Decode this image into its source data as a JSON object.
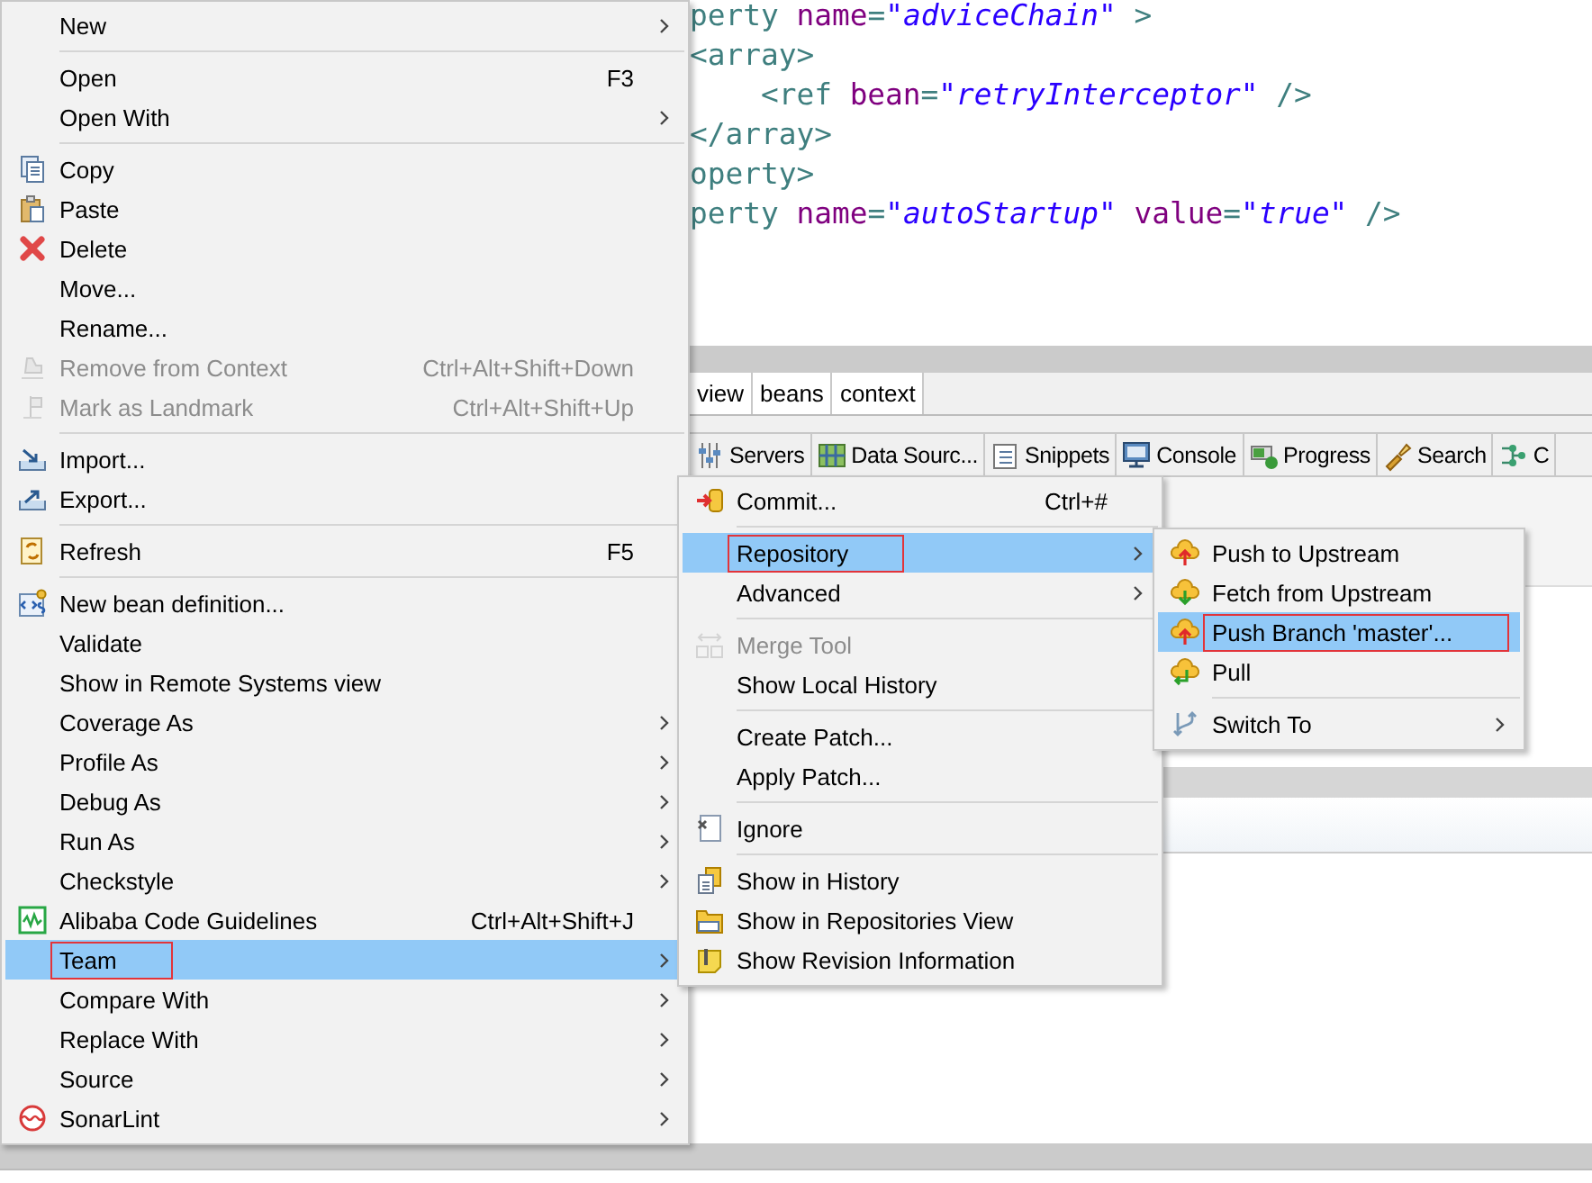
{
  "editor": {
    "lines": [
      [
        {
          "text": "perty ",
          "kind": "tag"
        },
        {
          "text": "name",
          "kind": "attr"
        },
        {
          "text": "=",
          "kind": "tag"
        },
        {
          "text": "\"adviceChain\"",
          "kind": "value"
        },
        {
          "text": " >",
          "kind": "tag"
        }
      ],
      [
        {
          "text": "<array>",
          "kind": "tag"
        }
      ],
      [
        {
          "text": "    <ref ",
          "kind": "tag"
        },
        {
          "text": "bean",
          "kind": "attr"
        },
        {
          "text": "=",
          "kind": "tag"
        },
        {
          "text": "\"retryInterceptor\"",
          "kind": "value"
        },
        {
          "text": " />",
          "kind": "tag"
        }
      ],
      [
        {
          "text": "</array>",
          "kind": "tag"
        }
      ],
      [
        {
          "text": "operty>",
          "kind": "tag"
        }
      ],
      [
        {
          "text": "perty ",
          "kind": "tag"
        },
        {
          "text": "name",
          "kind": "attr"
        },
        {
          "text": "=",
          "kind": "tag"
        },
        {
          "text": "\"autoStartup\"",
          "kind": "value"
        },
        {
          "text": " value",
          "kind": "attr"
        },
        {
          "text": "=",
          "kind": "tag"
        },
        {
          "text": "\"true\"",
          "kind": "value"
        },
        {
          "text": " />",
          "kind": "tag"
        }
      ]
    ]
  },
  "editor_tabs": [
    "view",
    "beans",
    "context"
  ],
  "view_tabs": [
    "Servers",
    "Data Sourc...",
    "Snippets",
    "Console",
    "Progress",
    "Search",
    "C"
  ],
  "main_menu": {
    "groups": [
      [
        {
          "label": "New",
          "submenu": true,
          "disabled": false,
          "selected": false,
          "annotated": false
        }
      ],
      [
        {
          "label": "Open",
          "shortcut": "F3",
          "submenu": false,
          "disabled": false,
          "selected": false,
          "annotated": false
        },
        {
          "label": "Open With",
          "submenu": true,
          "disabled": false,
          "selected": false,
          "annotated": false
        }
      ],
      [
        {
          "label": "Copy",
          "submenu": false,
          "disabled": false,
          "selected": false,
          "annotated": false
        },
        {
          "label": "Paste",
          "submenu": false,
          "disabled": false,
          "selected": false,
          "annotated": false
        },
        {
          "label": "Delete",
          "submenu": false,
          "disabled": false,
          "selected": false,
          "annotated": false
        },
        {
          "label": "Move...",
          "submenu": false,
          "disabled": false,
          "selected": false,
          "annotated": false
        },
        {
          "label": "Rename...",
          "submenu": false,
          "disabled": false,
          "selected": false,
          "annotated": false
        },
        {
          "label": "Remove from Context",
          "shortcut": "Ctrl+Alt+Shift+Down",
          "submenu": false,
          "disabled": true,
          "selected": false,
          "annotated": false
        },
        {
          "label": "Mark as Landmark",
          "shortcut": "Ctrl+Alt+Shift+Up",
          "submenu": false,
          "disabled": true,
          "selected": false,
          "annotated": false
        }
      ],
      [
        {
          "label": "Import...",
          "submenu": false,
          "disabled": false,
          "selected": false,
          "annotated": false
        },
        {
          "label": "Export...",
          "submenu": false,
          "disabled": false,
          "selected": false,
          "annotated": false
        }
      ],
      [
        {
          "label": "Refresh",
          "shortcut": "F5",
          "submenu": false,
          "disabled": false,
          "selected": false,
          "annotated": false
        }
      ],
      [
        {
          "label": "New bean definition...",
          "submenu": false,
          "disabled": false,
          "selected": false,
          "annotated": false
        },
        {
          "label": "Validate",
          "submenu": false,
          "disabled": false,
          "selected": false,
          "annotated": false
        },
        {
          "label": "Show in Remote Systems view",
          "submenu": false,
          "disabled": false,
          "selected": false,
          "annotated": false
        },
        {
          "label": "Coverage As",
          "submenu": true,
          "disabled": false,
          "selected": false,
          "annotated": false
        },
        {
          "label": "Profile As",
          "submenu": true,
          "disabled": false,
          "selected": false,
          "annotated": false
        },
        {
          "label": "Debug As",
          "submenu": true,
          "disabled": false,
          "selected": false,
          "annotated": false
        },
        {
          "label": "Run As",
          "submenu": true,
          "disabled": false,
          "selected": false,
          "annotated": false
        },
        {
          "label": "Checkstyle",
          "submenu": true,
          "disabled": false,
          "selected": false,
          "annotated": false
        },
        {
          "label": "Alibaba Code Guidelines",
          "shortcut": "Ctrl+Alt+Shift+J",
          "submenu": false,
          "disabled": false,
          "selected": false,
          "annotated": false
        },
        {
          "label": "Team",
          "submenu": true,
          "disabled": false,
          "selected": true,
          "annotated": true
        },
        {
          "label": "Compare With",
          "submenu": true,
          "disabled": false,
          "selected": false,
          "annotated": false
        },
        {
          "label": "Replace With",
          "submenu": true,
          "disabled": false,
          "selected": false,
          "annotated": false
        },
        {
          "label": "Source",
          "submenu": true,
          "disabled": false,
          "selected": false,
          "annotated": false
        },
        {
          "label": "SonarLint",
          "submenu": true,
          "disabled": false,
          "selected": false,
          "annotated": false
        }
      ]
    ]
  },
  "team_menu": {
    "groups": [
      [
        {
          "label": "Commit...",
          "shortcut": "Ctrl+#",
          "submenu": false,
          "disabled": false,
          "selected": false,
          "annotated": false
        }
      ],
      [
        {
          "label": "Repository",
          "submenu": true,
          "disabled": false,
          "selected": true,
          "annotated": true
        },
        {
          "label": "Advanced",
          "submenu": true,
          "disabled": false,
          "selected": false,
          "annotated": false
        }
      ],
      [
        {
          "label": "Merge Tool",
          "submenu": false,
          "disabled": true,
          "selected": false,
          "annotated": false
        },
        {
          "label": "Show Local History",
          "submenu": false,
          "disabled": false,
          "selected": false,
          "annotated": false
        }
      ],
      [
        {
          "label": "Create Patch...",
          "submenu": false,
          "disabled": false,
          "selected": false,
          "annotated": false
        },
        {
          "label": "Apply Patch...",
          "submenu": false,
          "disabled": false,
          "selected": false,
          "annotated": false
        }
      ],
      [
        {
          "label": "Ignore",
          "submenu": false,
          "disabled": false,
          "selected": false,
          "annotated": false
        }
      ],
      [
        {
          "label": "Show in History",
          "submenu": false,
          "disabled": false,
          "selected": false,
          "annotated": false
        },
        {
          "label": "Show in Repositories View",
          "submenu": false,
          "disabled": false,
          "selected": false,
          "annotated": false
        },
        {
          "label": "Show Revision Information",
          "submenu": false,
          "disabled": false,
          "selected": false,
          "annotated": false
        }
      ]
    ]
  },
  "repository_menu": {
    "groups": [
      [
        {
          "label": "Push to Upstream",
          "submenu": false,
          "disabled": false,
          "selected": false,
          "annotated": false
        },
        {
          "label": "Fetch from Upstream",
          "submenu": false,
          "disabled": false,
          "selected": false,
          "annotated": false
        },
        {
          "label": "Push Branch 'master'...",
          "submenu": false,
          "disabled": false,
          "selected": true,
          "annotated": true
        },
        {
          "label": "Pull",
          "submenu": false,
          "disabled": false,
          "selected": false,
          "annotated": false
        }
      ],
      [
        {
          "label": "Switch To",
          "submenu": true,
          "disabled": false,
          "selected": false,
          "annotated": false
        }
      ]
    ]
  }
}
